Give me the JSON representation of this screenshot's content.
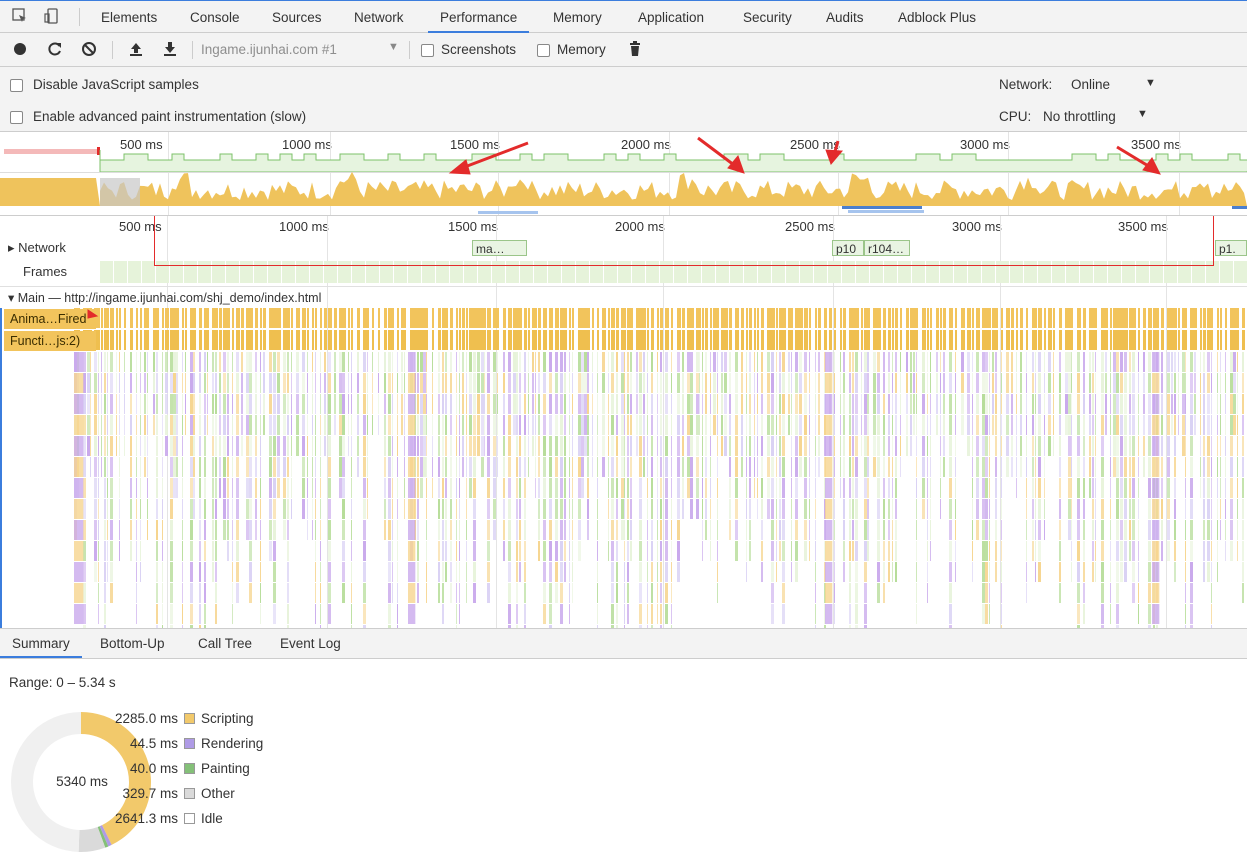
{
  "devtools_tabs": [
    "Elements",
    "Console",
    "Sources",
    "Network",
    "Performance",
    "Memory",
    "Application",
    "Security",
    "Audits",
    "Adblock Plus"
  ],
  "active_tab": "Performance",
  "toolbar": {
    "profile_select": "Ingame.ijunhai.com #1",
    "screenshots_label": "Screenshots",
    "memory_label": "Memory"
  },
  "settings": {
    "disable_js_samples": "Disable JavaScript samples",
    "advanced_paint": "Enable advanced paint instrumentation (slow)",
    "network_label": "Network:",
    "network_value": "Online",
    "cpu_label": "CPU:",
    "cpu_value": "No throttling"
  },
  "overview_ticks": [
    "500 ms",
    "1000 ms",
    "1500 ms",
    "2000 ms",
    "2500 ms",
    "3000 ms",
    "3500 ms"
  ],
  "timeline_ticks": [
    "500 ms",
    "1000 ms",
    "1500 ms",
    "2000 ms",
    "2500 ms",
    "3000 ms",
    "3500 ms"
  ],
  "tracks": {
    "network": "Network",
    "frames": "Frames",
    "main": "Main — http://ingame.ijunhai.com/shj_demo/index.html"
  },
  "network_requests": [
    "ma…",
    "p10",
    "r104…",
    "p1."
  ],
  "main_events": [
    "Anima…Fired",
    "Functi…js:2)"
  ],
  "bottom_tabs": [
    "Summary",
    "Bottom-Up",
    "Call Tree",
    "Event Log"
  ],
  "summary": {
    "range": "Range: 0 – 5.34 s",
    "total": "5340 ms",
    "rows": [
      {
        "value": "2285.0 ms",
        "label": "Scripting",
        "color": "#f2c96b",
        "ms": 2285.0
      },
      {
        "value": "44.5 ms",
        "label": "Rendering",
        "color": "#af9be6",
        "ms": 44.5
      },
      {
        "value": "40.0 ms",
        "label": "Painting",
        "color": "#84c078",
        "ms": 40.0
      },
      {
        "value": "329.7 ms",
        "label": "Other",
        "color": "#dadada",
        "ms": 329.7
      },
      {
        "value": "2641.3 ms",
        "label": "Idle",
        "color": "#ffffff",
        "ms": 2641.3
      }
    ]
  },
  "colors": {
    "accent": "#3b7ddd",
    "scripting": "#f2c45c",
    "rendering": "#c9a9ec",
    "painting": "#b7dd9a",
    "annotation": "#e32b2b"
  }
}
